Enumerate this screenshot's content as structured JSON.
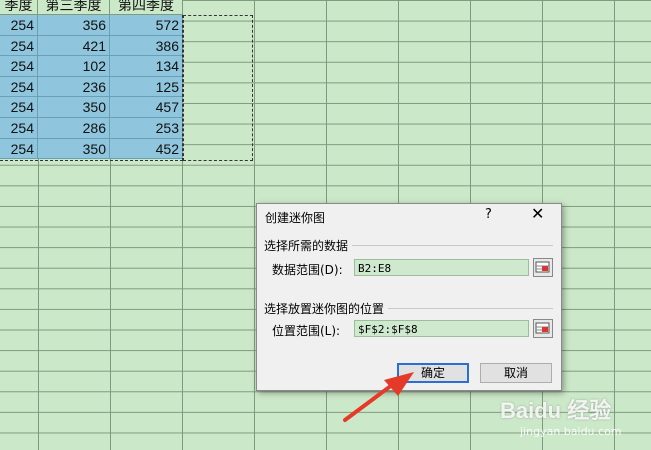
{
  "sheet": {
    "headers": [
      "季度",
      "第三季度",
      "第四季度"
    ],
    "rows": [
      [
        "254",
        "356",
        "572"
      ],
      [
        "254",
        "421",
        "386"
      ],
      [
        "254",
        "102",
        "134"
      ],
      [
        "254",
        "236",
        "125"
      ],
      [
        "254",
        "350",
        "457"
      ],
      [
        "254",
        "286",
        "253"
      ],
      [
        "254",
        "350",
        "452"
      ]
    ]
  },
  "dialog": {
    "title": "创建迷你图",
    "help": "?",
    "close": "✕",
    "data_group": "选择所需的数据",
    "data_range_label": "数据范围(D):",
    "data_range_value": "B2:E8",
    "location_group": "选择放置迷你图的位置",
    "location_label": "位置范围(L):",
    "location_value": "$F$2:$F$8",
    "ok": "确定",
    "cancel": "取消"
  },
  "watermark": {
    "brand": "Baidu 经验",
    "url": "jingyan.baidu.com"
  },
  "colors": {
    "grid": "#cbe8c8",
    "selection": "#8fc6dd",
    "arrow": "#e53a2a",
    "ok_border": "#2a6fd6"
  }
}
